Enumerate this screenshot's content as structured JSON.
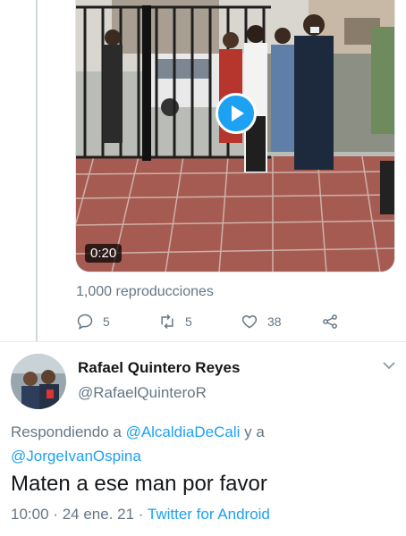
{
  "video": {
    "duration": "0:20",
    "views": "1,000 reproducciones"
  },
  "actions": {
    "reply_count": "5",
    "retweet_count": "5",
    "like_count": "38",
    "icons": [
      "reply-icon",
      "retweet-icon",
      "like-icon",
      "share-icon"
    ]
  },
  "reply": {
    "display_name": "Rafael Quintero Reyes",
    "handle": "@RafaelQuinteroR",
    "replying_prefix": "Respondiendo a",
    "mention_1": "@AlcaldiaDeCali",
    "conjunction": "y a",
    "mention_2": "@JorgeIvanOspina",
    "text": "Maten a ese man por favor",
    "time": "10:00",
    "separator": "·",
    "date": "24 ene. 21",
    "source": "Twitter for Android"
  },
  "colors": {
    "accent": "#1da1f2",
    "secondary_text": "#657786",
    "primary_text": "#14171a"
  }
}
